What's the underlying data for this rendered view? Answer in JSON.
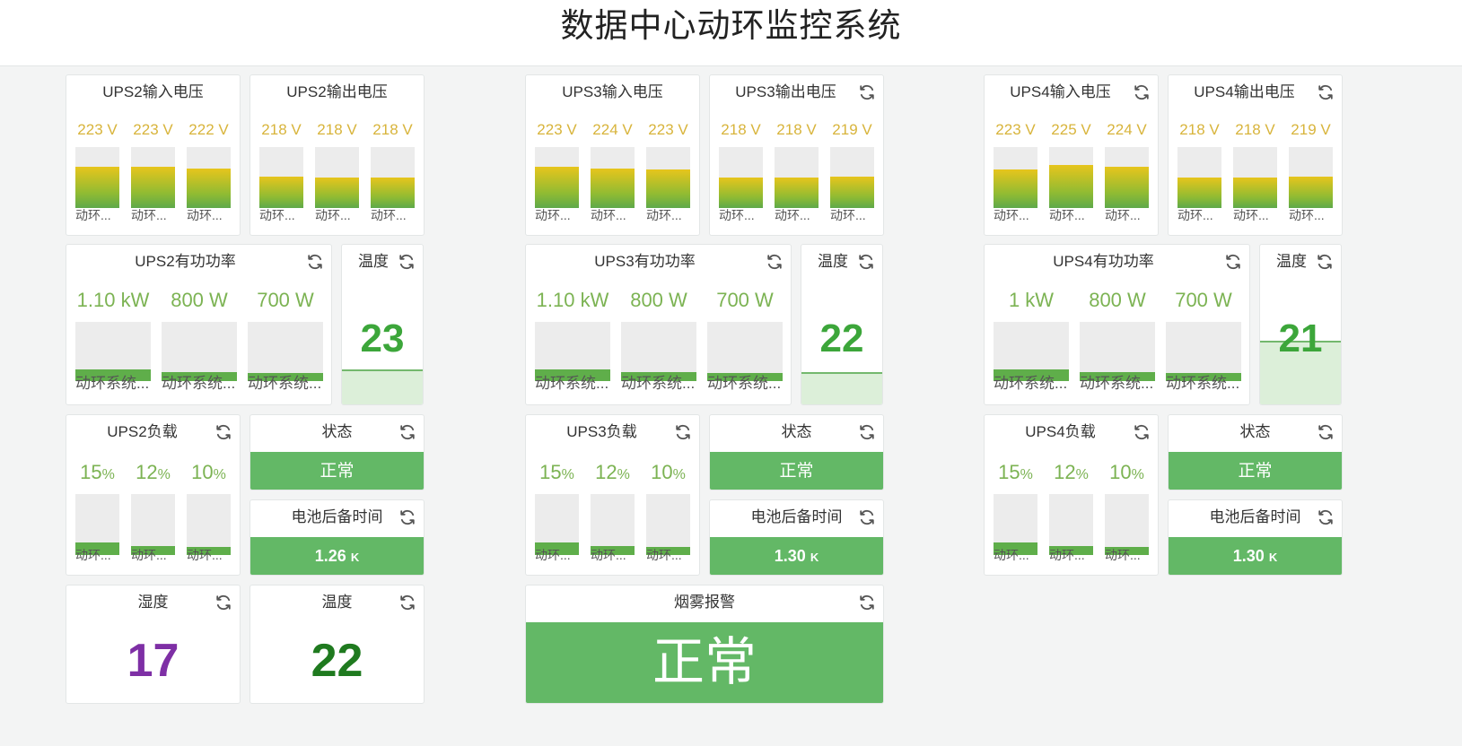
{
  "title": "数据中心动环监控系统",
  "colors": {
    "voltage_fill": "#e7c51c",
    "green_fill": "#5fae4a",
    "humidity": "#7e2fa5",
    "temperature": "#3ca63a",
    "status_box": "#63b866"
  },
  "groups": [
    {
      "input_voltage": {
        "title": "UPS2输入电压",
        "values": [
          "223 V",
          "223 V",
          "222 V"
        ],
        "levels": [
          0.67,
          0.67,
          0.65
        ],
        "names": [
          "动环...",
          "动环...",
          "动环..."
        ]
      },
      "output_voltage": {
        "title": "UPS2输出电压",
        "values": [
          "218 V",
          "218 V",
          "218 V"
        ],
        "levels": [
          0.52,
          0.5,
          0.5
        ],
        "names": [
          "动环...",
          "动环...",
          "动环..."
        ]
      },
      "active_power": {
        "title": "UPS2有功功率",
        "values": [
          "1.10 kW",
          "800 W",
          "700 W"
        ],
        "levels": [
          0.2,
          0.15,
          0.13
        ],
        "names": [
          "动环系统...",
          "动环系统...",
          "动环系统..."
        ]
      },
      "temperature": {
        "title": "温度",
        "value": "23",
        "level": 0.22
      },
      "load": {
        "title": "UPS2负载",
        "values": [
          "15",
          "12",
          "10"
        ],
        "unit": "%",
        "levels": [
          0.2,
          0.15,
          0.13
        ],
        "names": [
          "动环...",
          "动环...",
          "动环..."
        ]
      },
      "status": {
        "title": "状态",
        "value": "正常"
      },
      "battery": {
        "title": "电池后备时间",
        "value": "1.26",
        "unit": "K"
      }
    },
    {
      "input_voltage": {
        "title": "UPS3输入电压",
        "values": [
          "223 V",
          "224 V",
          "223 V"
        ],
        "levels": [
          0.67,
          0.65,
          0.63
        ],
        "names": [
          "动环...",
          "动环...",
          "动环..."
        ]
      },
      "output_voltage": {
        "title": "UPS3输出电压",
        "values": [
          "218 V",
          "218 V",
          "219 V"
        ],
        "levels": [
          0.5,
          0.5,
          0.52
        ],
        "names": [
          "动环...",
          "动环...",
          "动环..."
        ]
      },
      "active_power": {
        "title": "UPS3有功功率",
        "values": [
          "1.10 kW",
          "800 W",
          "700 W"
        ],
        "levels": [
          0.2,
          0.15,
          0.13
        ],
        "names": [
          "动环系统...",
          "动环系统...",
          "动环系统..."
        ]
      },
      "temperature": {
        "title": "温度",
        "value": "22",
        "level": 0.2
      },
      "load": {
        "title": "UPS3负载",
        "values": [
          "15",
          "12",
          "10"
        ],
        "unit": "%",
        "levels": [
          0.2,
          0.15,
          0.13
        ],
        "names": [
          "动环...",
          "动环...",
          "动环..."
        ]
      },
      "status": {
        "title": "状态",
        "value": "正常"
      },
      "battery": {
        "title": "电池后备时间",
        "value": "1.30",
        "unit": "K"
      }
    },
    {
      "input_voltage": {
        "title": "UPS4输入电压",
        "values": [
          "223 V",
          "225 V",
          "224 V"
        ],
        "levels": [
          0.63,
          0.7,
          0.67
        ],
        "names": [
          "动环...",
          "动环...",
          "动环..."
        ]
      },
      "output_voltage": {
        "title": "UPS4输出电压",
        "values": [
          "218 V",
          "218 V",
          "219 V"
        ],
        "levels": [
          0.5,
          0.5,
          0.52
        ],
        "names": [
          "动环...",
          "动环...",
          "动环..."
        ]
      },
      "active_power": {
        "title": "UPS4有功功率",
        "values": [
          "1 kW",
          "800 W",
          "700 W"
        ],
        "levels": [
          0.2,
          0.15,
          0.13
        ],
        "names": [
          "动环系统...",
          "动环系统...",
          "动环系统..."
        ]
      },
      "temperature": {
        "title": "温度",
        "value": "21",
        "level": 0.4
      },
      "load": {
        "title": "UPS4负载",
        "values": [
          "15",
          "12",
          "10"
        ],
        "unit": "%",
        "levels": [
          0.2,
          0.15,
          0.13
        ],
        "names": [
          "动环...",
          "动环...",
          "动环..."
        ]
      },
      "status": {
        "title": "状态",
        "value": "正常"
      },
      "battery": {
        "title": "电池后备时间",
        "value": "1.30",
        "unit": "K"
      }
    }
  ],
  "humidity": {
    "title": "湿度",
    "value": "17"
  },
  "room_temperature": {
    "title": "温度",
    "value": "22"
  },
  "smoke_alarm": {
    "title": "烟雾报警",
    "value": "正常"
  }
}
